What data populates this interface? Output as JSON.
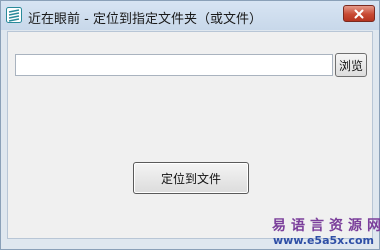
{
  "window": {
    "title": "近在眼前 - 定位到指定文件夹（或文件）",
    "app_icon": "app-logo-icon",
    "close_icon": "close-icon"
  },
  "form": {
    "path_value": "",
    "browse_label": "浏览",
    "locate_label": "定位到文件"
  },
  "watermark": {
    "site_name": "易语言资源网",
    "url": "www.e5a5x.com"
  },
  "colors": {
    "close_button": "#c84a34",
    "watermark_cn": "#7b3f9b",
    "watermark_en": "#2f4fa6"
  }
}
